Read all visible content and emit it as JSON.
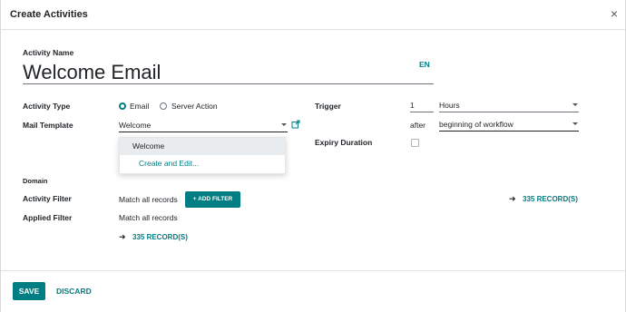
{
  "dialog": {
    "title": "Create Activities",
    "close": "×"
  },
  "name": {
    "label": "Activity Name",
    "value": "Welcome Email",
    "lang": "EN"
  },
  "activity_type": {
    "label": "Activity Type",
    "options": [
      "Email",
      "Server Action"
    ],
    "selected": "Email"
  },
  "mail_template": {
    "label": "Mail Template",
    "value": "Welcome"
  },
  "dropdown": {
    "items": [
      "Welcome",
      "Create and Edit..."
    ]
  },
  "trigger": {
    "label": "Trigger",
    "number": "1",
    "unit": "Hours",
    "after": "after",
    "event": "beginning of workflow"
  },
  "expiry": {
    "label": "Expiry Duration",
    "checked": false
  },
  "domain": {
    "label": "Domain",
    "activity_filter_label": "Activity Filter",
    "activity_filter_value": "Match all records",
    "add_filter": "+ ADD FILTER",
    "records_right": "335 RECORD(S)",
    "applied_filter_label": "Applied Filter",
    "applied_filter_value": "Match all records",
    "records_below": "335 RECORD(S)"
  },
  "footer": {
    "save": "SAVE",
    "discard": "DISCARD"
  },
  "colors": {
    "accent": "#017e84"
  }
}
